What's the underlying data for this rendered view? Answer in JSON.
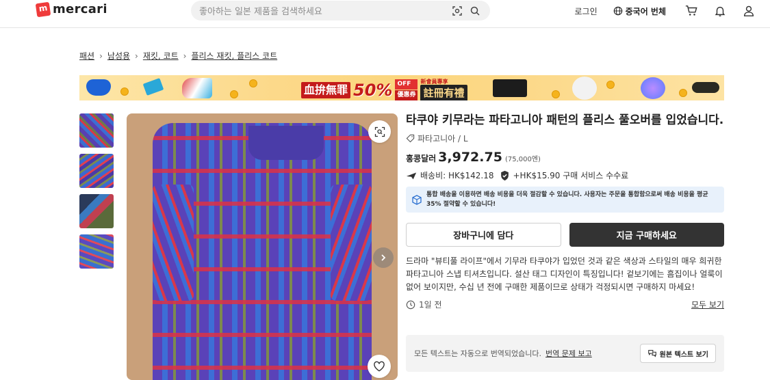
{
  "header": {
    "logo_text": "mercari",
    "search_placeholder": "좋아하는 일본 제품을 검색하세요",
    "login": "로그인",
    "language": "중국어 번체"
  },
  "breadcrumb": [
    "패션",
    "남성용",
    "재킷, 코트",
    "플리스 재킷, 플리스 코트"
  ],
  "banner": {
    "badge_left": "血拚無罪",
    "big": "50%",
    "off": "OFF",
    "coupon": "優惠券",
    "badge_right": "註冊有禮",
    "tag": "新會員專享"
  },
  "product": {
    "title": "타쿠야 키무라는 파타고니아 패턴의 플리스 풀오버를 입었습니다.",
    "brand_size": "파타고니아 / L",
    "currency_label": "홍콩달러",
    "price": "3,972.75",
    "yen_price": "(75,000엔)",
    "shipping": "배송비: HK$142.18",
    "service_fee": "+HK$15.90 구매 서비스 수수료",
    "notice": "통합 배송을 이용하면 배송 비용을 더욱 절감할 수 있습니다. 사용자는 주문을 통합함으로써 배송 비용을 평균 35% 절약할 수 있습니다!",
    "cart_button": "장바구니에 담다",
    "buy_button": "지금 구매하세요",
    "description": "드라마 \"뷰티풀 라이프\"에서 기무라 타쿠야가 입었던 것과 같은 색상과 스타일의 매우 희귀한 파타고니아 스냅 티셔츠입니다. 설산 태그 디자인이 특징입니다! 겉보기에는 흠집이나 얼룩이 없어 보이지만, 수십 년 전에 구매한 제품이므로 상태가 걱정되시면 구매하지 마세요!",
    "posted_ago": "1일 전",
    "see_all": "모두 보기"
  },
  "translation": {
    "notice": "모든 텍스트는 자동으로 번역되었습니다.",
    "report_link": "번역 문제 보고",
    "original_button": "원본 텍스트 보기"
  },
  "colors": {
    "brand_red": "#ef3b3b",
    "buy_button_bg": "#333333",
    "notice_bg": "#e8f1fb"
  },
  "icons": [
    "search-icon",
    "image-search-icon",
    "globe-icon",
    "cart-icon",
    "bell-icon",
    "user-icon",
    "tag-icon",
    "plane-icon",
    "shield-check-icon",
    "box-icon",
    "clock-icon",
    "zoom-icon",
    "chevron-right-icon",
    "heart-icon",
    "translate-icon"
  ]
}
